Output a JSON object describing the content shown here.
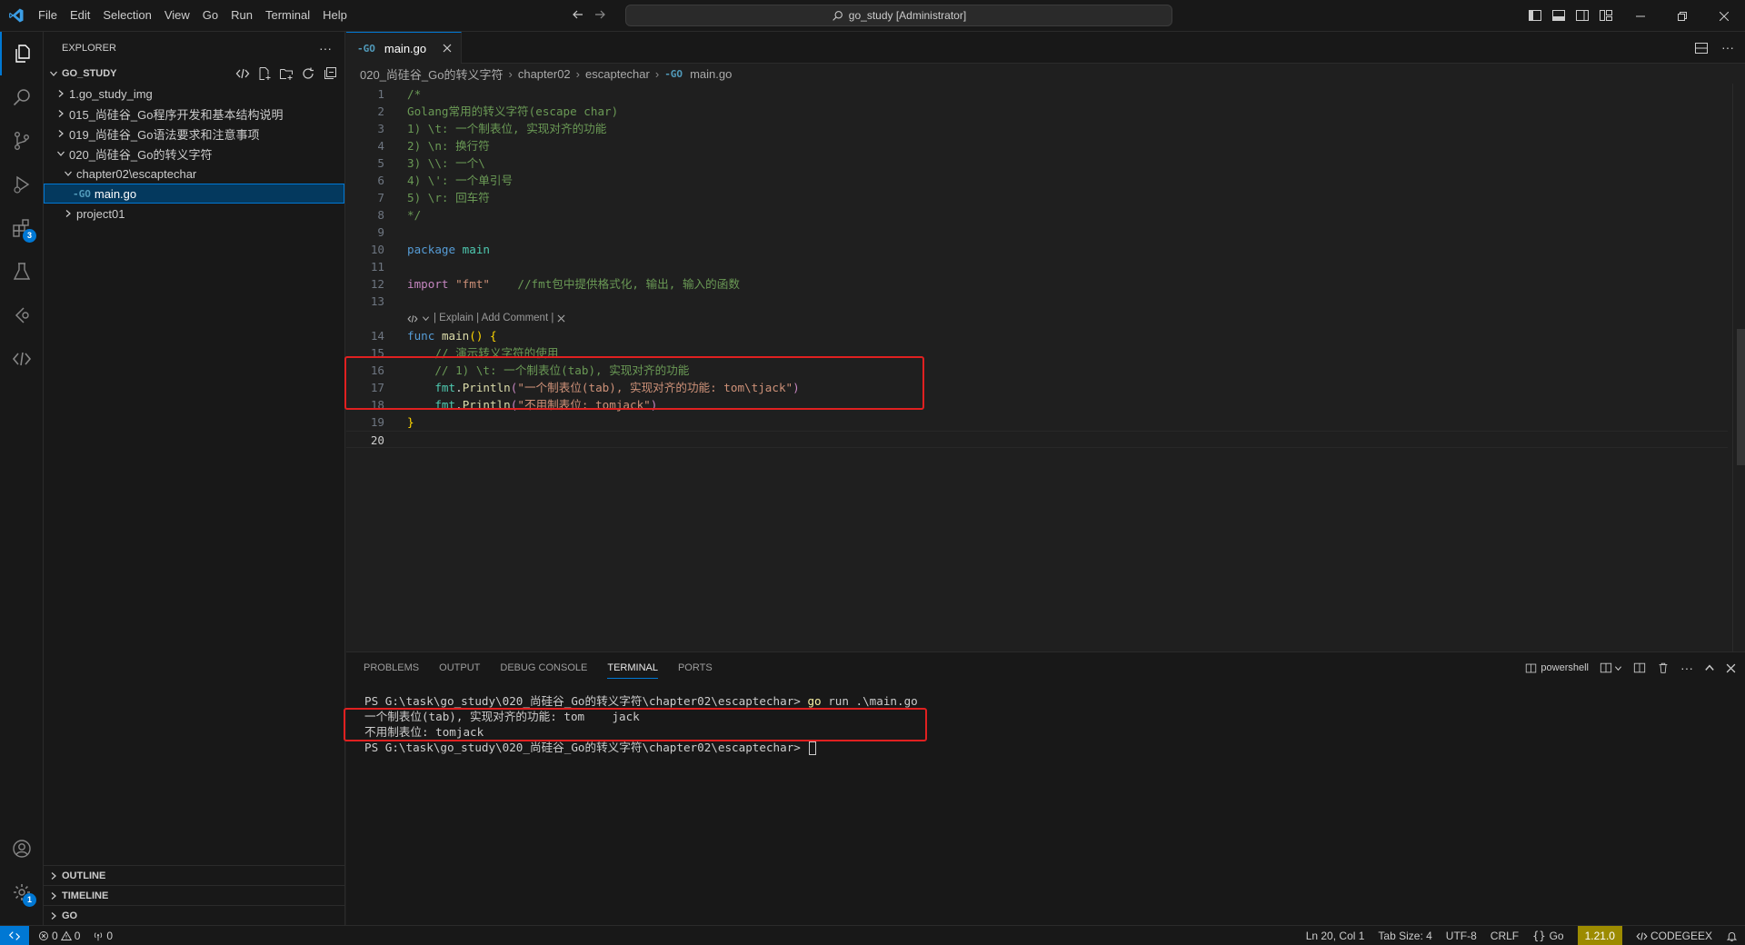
{
  "titlebar": {
    "menu": [
      "File",
      "Edit",
      "Selection",
      "View",
      "Go",
      "Run",
      "Terminal",
      "Help"
    ],
    "search": "go_study [Administrator]"
  },
  "activitybar": {
    "extensions_badge": "3",
    "settings_badge": "1"
  },
  "sidebar": {
    "title": "EXPLORER",
    "workspace": "GO_STUDY",
    "tree": [
      {
        "label": "1.go_study_img",
        "level": 1,
        "expanded": false,
        "type": "folder"
      },
      {
        "label": "015_尚硅谷_Go程序开发和基本结构说明",
        "level": 1,
        "expanded": false,
        "type": "folder"
      },
      {
        "label": "019_尚硅谷_Go语法要求和注意事项",
        "level": 1,
        "expanded": false,
        "type": "folder"
      },
      {
        "label": "020_尚硅谷_Go的转义字符",
        "level": 1,
        "expanded": true,
        "type": "folder"
      },
      {
        "label": "chapter02\\escaptechar",
        "level": 2,
        "expanded": true,
        "type": "folder"
      },
      {
        "label": "main.go",
        "level": 3,
        "type": "file",
        "selected": true
      },
      {
        "label": "project01",
        "level": 2,
        "expanded": false,
        "type": "folder"
      }
    ],
    "bottom_sections": [
      "OUTLINE",
      "TIMELINE",
      "GO"
    ]
  },
  "editor": {
    "tab_label": "main.go",
    "breadcrumb": [
      "020_尚硅谷_Go的转义字符",
      "chapter02",
      "escaptechar",
      "main.go"
    ],
    "codelens": "| Explain | Add Comment |",
    "lines": {
      "l1": "/*",
      "l2": "Golang常用的转义字符(escape char)",
      "l3": "1) \\t: 一个制表位, 实现对齐的功能",
      "l4": "2) \\n: 换行符",
      "l5": "3) \\\\: 一个\\",
      "l6": "4) \\': 一个单引号",
      "l7": "5) \\r: 回车符",
      "l8": "*/",
      "l10_kw": "package",
      "l10_name": "main",
      "l12_kw": "import",
      "l12_str": "\"fmt\"",
      "l12_cm": "//fmt包中提供格式化, 输出, 输入的函数",
      "l14_kw": "func",
      "l14_fn": "main",
      "l15": "// 演示转义字符的使用",
      "l16": "// 1) \\t: 一个制表位(tab), 实现对齐的功能",
      "l17_pkg": "fmt",
      "l17_fn": "Println",
      "l17_str": "\"一个制表位(tab), 实现对齐的功能: tom\\tjack\"",
      "l18_pkg": "fmt",
      "l18_fn": "Println",
      "l18_str": "\"不用制表位: tomjack\"",
      "l19": "}"
    }
  },
  "panel": {
    "tabs": [
      "PROBLEMS",
      "OUTPUT",
      "DEBUG CONSOLE",
      "TERMINAL",
      "PORTS"
    ],
    "active_tab": "TERMINAL",
    "shell": "powershell",
    "terminal": {
      "prompt1": "PS G:\\task\\go_study\\020_尚硅谷_Go的转义字符\\chapter02\\escaptechar> ",
      "cmd1_go": "go",
      "cmd1_rest": " run .\\main.go",
      "out1": "一个制表位(tab), 实现对齐的功能: tom    jack",
      "out2": "不用制表位: tomjack",
      "prompt2": "PS G:\\task\\go_study\\020_尚硅谷_Go的转义字符\\chapter02\\escaptechar> "
    }
  },
  "statusbar": {
    "errors": "0",
    "warnings": "0",
    "ports": "0",
    "position": "Ln 20, Col 1",
    "tab_size": "Tab Size: 4",
    "encoding": "UTF-8",
    "eol": "CRLF",
    "language": "Go",
    "go_version": "1.21.0",
    "codegeex": "CODEGEEX"
  },
  "colors": {
    "accent": "#0078d4",
    "highlight_box": "#e02020",
    "go_version_bg": "#9c8b00"
  }
}
